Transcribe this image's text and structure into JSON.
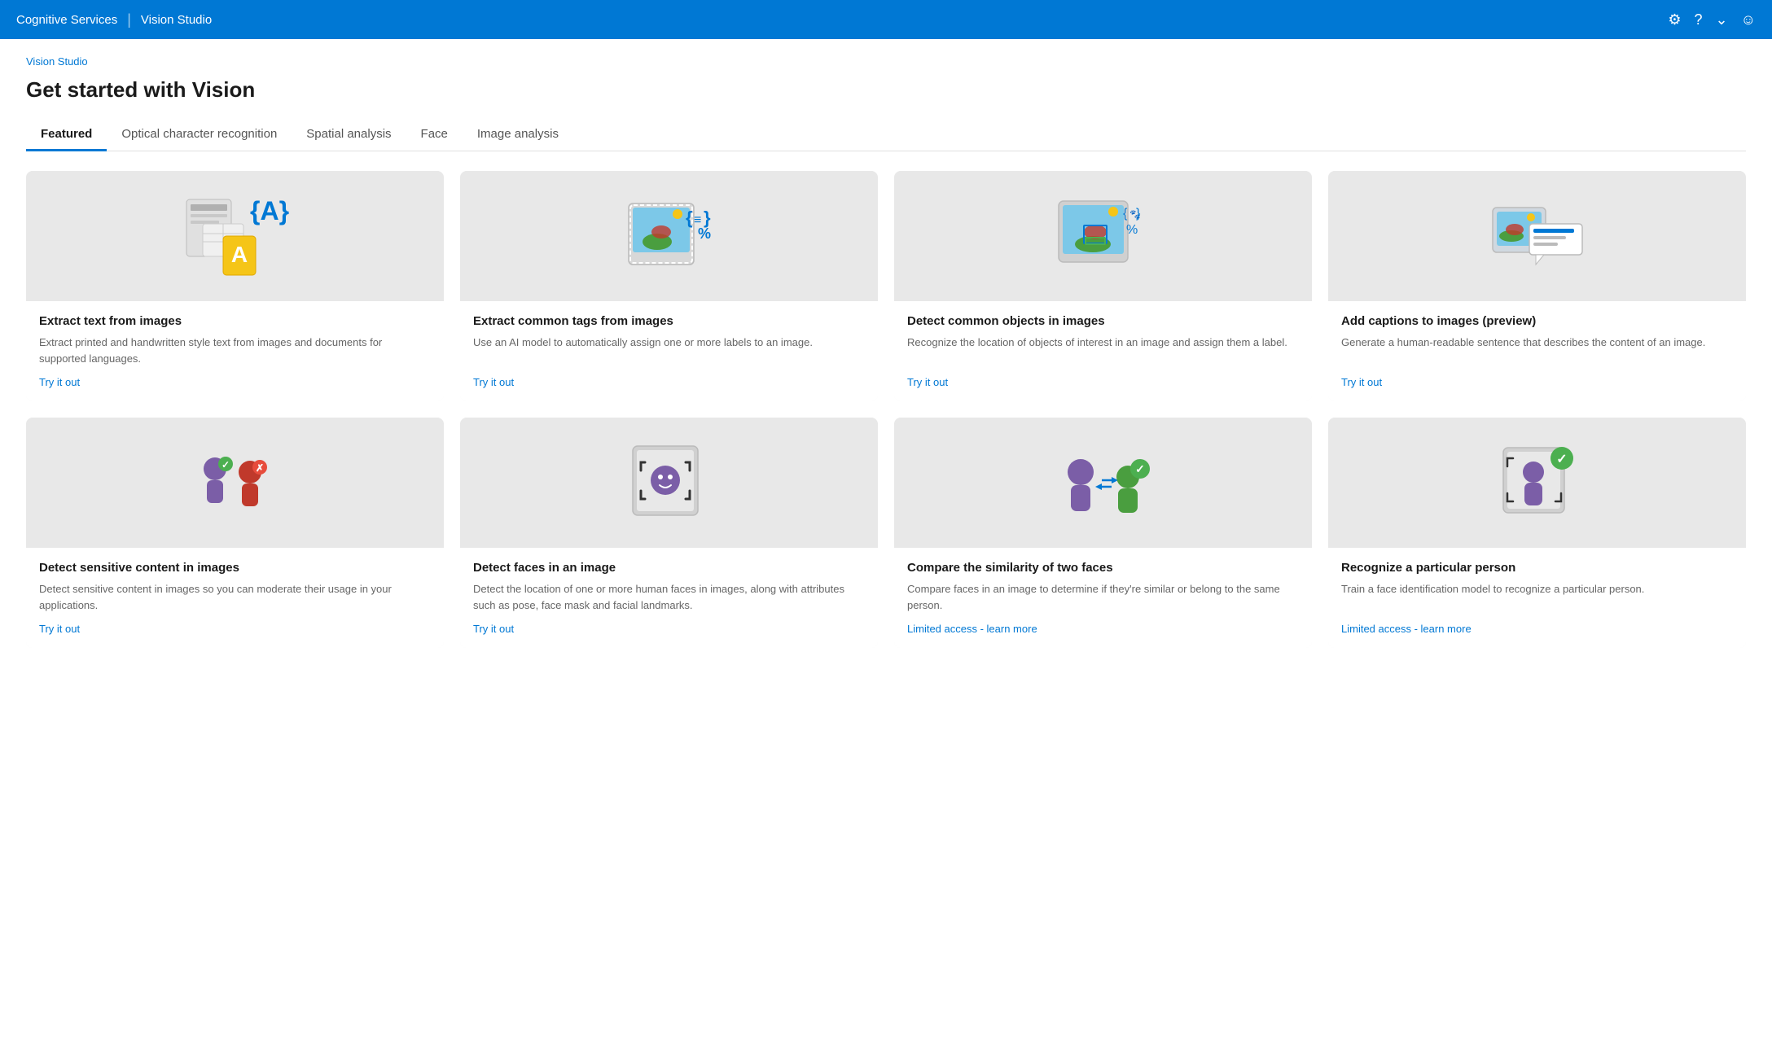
{
  "topnav": {
    "brand": "Cognitive Services",
    "divider": "|",
    "app_name": "Vision Studio",
    "icons": [
      "settings",
      "help",
      "chevron-down",
      "account"
    ]
  },
  "breadcrumb": "Vision Studio",
  "page_title": "Get started with Vision",
  "tabs": [
    {
      "label": "Featured",
      "active": true
    },
    {
      "label": "Optical character recognition",
      "active": false
    },
    {
      "label": "Spatial analysis",
      "active": false
    },
    {
      "label": "Face",
      "active": false
    },
    {
      "label": "Image analysis",
      "active": false
    }
  ],
  "row1_cards": [
    {
      "title": "Extract text from images",
      "desc": "Extract printed and handwritten style text from images and documents for supported languages.",
      "link": "Try it out",
      "link_type": "try"
    },
    {
      "title": "Extract common tags from images",
      "desc": "Use an AI model to automatically assign one or more labels to an image.",
      "link": "Try it out",
      "link_type": "try"
    },
    {
      "title": "Detect common objects in images",
      "desc": "Recognize the location of objects of interest in an image and assign them a label.",
      "link": "Try it out",
      "link_type": "try"
    },
    {
      "title": "Add captions to images (preview)",
      "desc": "Generate a human-readable sentence that describes the content of an image.",
      "link": "Try it out",
      "link_type": "try"
    }
  ],
  "row2_cards": [
    {
      "title": "Detect sensitive content in images",
      "desc": "Detect sensitive content in images so you can moderate their usage in your applications.",
      "link": "Try it out",
      "link_type": "try"
    },
    {
      "title": "Detect faces in an image",
      "desc": "Detect the location of one or more human faces in images, along with attributes such as pose, face mask and facial landmarks.",
      "link": "Try it out",
      "link_type": "try"
    },
    {
      "title": "Compare the similarity of two faces",
      "desc": "Compare faces in an image to determine if they're similar or belong to the same person.",
      "link": "Limited access - learn more",
      "link_type": "limited"
    },
    {
      "title": "Recognize a particular person",
      "desc": "Train a face identification model to recognize a particular person.",
      "link": "Limited access - learn more",
      "link_type": "limited"
    }
  ]
}
